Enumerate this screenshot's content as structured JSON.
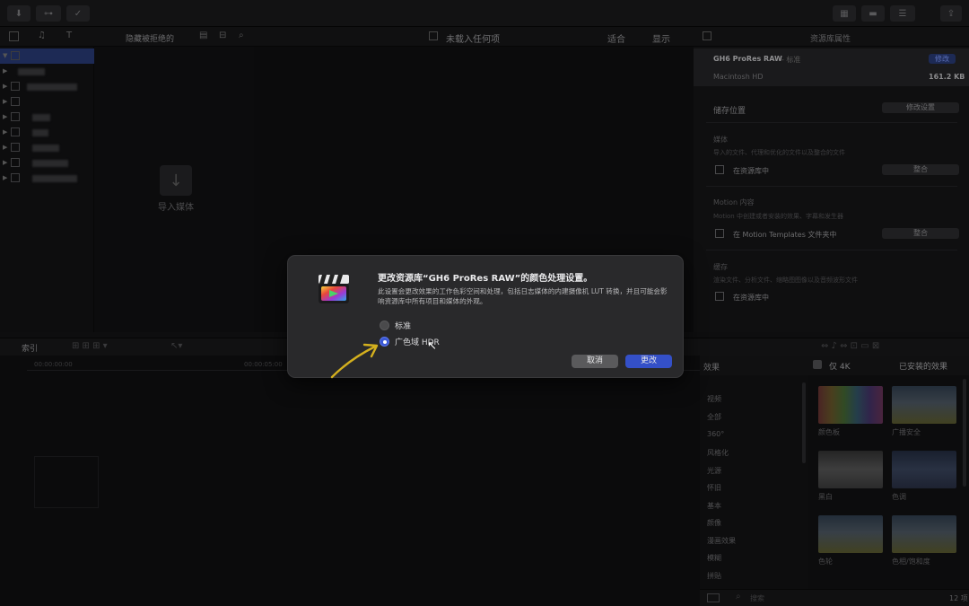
{
  "browser": {
    "filter_label": "隐藏被拒绝的",
    "import_label": "导入媒体"
  },
  "viewer": {
    "title": "未载入任何项",
    "fit_label": "适合",
    "display_label": "显示"
  },
  "inspector": {
    "title": "资源库属性",
    "library_name": "GH6 ProRes RAW",
    "library_suffix": "- 标准",
    "modify_badge": "修改",
    "volume": "Macintosh HD",
    "size": "161.2 KB",
    "storage_title": "储存位置",
    "modify_settings_btn": "修改设置",
    "media_title": "媒体",
    "media_desc": "导入的文件、代理和优化的文件以及整合的文件",
    "media_location": "在资源库中",
    "consolidate_btn": "整合",
    "motion_title": "Motion 内容",
    "motion_desc": "Motion 中创建或者安装的效果、字幕和发生器",
    "motion_location": "在 Motion Templates 文件夹中",
    "consolidate_btn2": "整合",
    "cache_title": "缓存",
    "cache_desc": "渲染文件、分析文件、缩略图图像以及音频波形文件",
    "cache_location": "在资源库中"
  },
  "mid": {
    "index_label": "索引",
    "tc1": "00:00:00:00",
    "tc2": "00:00:05:00"
  },
  "effects": {
    "title": "效果",
    "only4k": "仅 4K",
    "installed": "已安装的效果",
    "categories": [
      "视频",
      "全部",
      "360°",
      "风格化",
      "光源",
      "怀旧",
      "基本",
      "颜像",
      "漫画效果",
      "模糊",
      "拼贴"
    ],
    "thumbs": [
      "颜色板",
      "广播安全",
      "黑白",
      "色调",
      "色轮",
      "色相/饱和度"
    ],
    "search_placeholder": "搜索",
    "count": "12 项"
  },
  "dialog": {
    "title": "更改资源库“GH6 ProRes RAW”的颜色处理设置。",
    "body": "此设置会更改效果的工作色彩空间和处理，包括日志媒体的内建摄像机 LUT 转换，并且可能会影响资源库中所有项目和媒体的外观。",
    "option_standard": "标准",
    "option_hdr": "广色域 HDR",
    "selected": "广色域 HDR",
    "cancel": "取消",
    "change": "更改"
  },
  "colors": {
    "accent": "#3450c8",
    "selection": "#1d2a55",
    "annotation_arrow": "#d4b01e"
  }
}
